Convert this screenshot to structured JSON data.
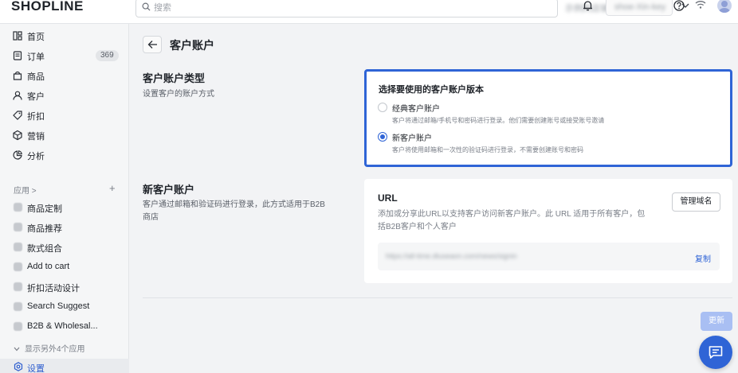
{
  "header": {
    "logo": "SHOPLINE",
    "search_placeholder": "搜索",
    "store_name": "示例的店铺 (Redbull, 播客...",
    "staff_name": "shoe-Xin-key"
  },
  "sidebar": {
    "items": [
      {
        "label": "首页",
        "icon": "home-icon"
      },
      {
        "label": "订单",
        "icon": "orders-icon",
        "badge": "369"
      },
      {
        "label": "商品",
        "icon": "products-icon"
      },
      {
        "label": "客户",
        "icon": "customers-icon"
      },
      {
        "label": "折扣",
        "icon": "discount-icon"
      },
      {
        "label": "营销",
        "icon": "marketing-icon"
      },
      {
        "label": "分析",
        "icon": "analytics-icon"
      }
    ],
    "apps_header": "应用 >",
    "apps_plus": "+",
    "apps": [
      {
        "label": "商品定制"
      },
      {
        "label": "商品推荐"
      },
      {
        "label": "款式组合"
      },
      {
        "label": "Add to cart"
      },
      {
        "label": "折扣活动设计"
      },
      {
        "label": "Search Suggest"
      },
      {
        "label": "B2B & Wholesal..."
      }
    ],
    "more_apps": "显示另外4个应用",
    "settings_label": "设置"
  },
  "page": {
    "title": "客户账户",
    "type_section": {
      "title": "客户账户类型",
      "desc": "设置客户的账户方式"
    },
    "type_card": {
      "question": "选择要使用的客户账户版本",
      "options": [
        {
          "title": "经典客户账户",
          "desc": "客户将通过邮箱/手机号和密码进行登录。他们需要创建账号或接受账号邀请",
          "checked": false
        },
        {
          "title": "新客户账户",
          "desc": "客户将使用邮箱和一次性的验证码进行登录，不需要创建账号和密码",
          "checked": true
        }
      ]
    },
    "new_section": {
      "title": "新客户账户",
      "desc": "客户通过邮箱和验证码进行登录，此方式适用于B2B商店"
    },
    "url_card": {
      "title": "URL",
      "desc": "添加或分享此URL以支持客户访问新客户账户。此 URL 适用于所有客户，包括B2B客户和个人客户",
      "manage_btn": "管理域名",
      "url_value": "https://all-time.dtuseaon.com/news/signin",
      "copy_label": "复制"
    },
    "update_btn": "更新"
  },
  "colors": {
    "accent": "#2f64d6",
    "highlight_border": "#2f64d6",
    "update_disabled": "#a9bff3"
  }
}
